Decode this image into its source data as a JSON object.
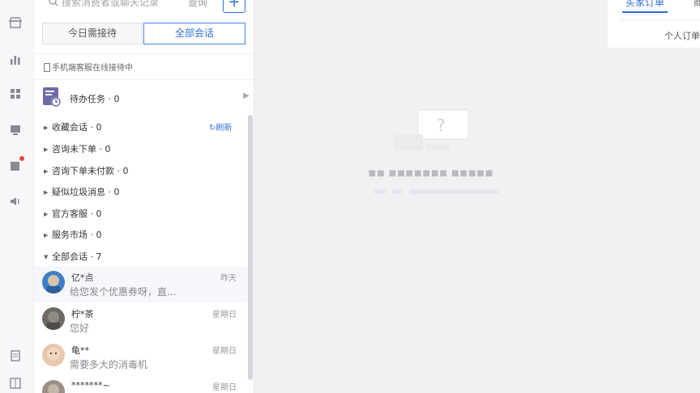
{
  "search": {
    "placeholder": "搜索消费者或聊天记录",
    "button_label": "查询",
    "add_symbol": "+"
  },
  "tabs": [
    {
      "label": "今日需接待"
    },
    {
      "label": "全部会话"
    }
  ],
  "mobile_notice": "手机端客服在线接待中",
  "todo": {
    "label": "待办任务 · 0"
  },
  "refresh_label": "刷新",
  "groups": [
    {
      "label": "收藏会话 · 0"
    },
    {
      "label": "咨询未下单 · 0"
    },
    {
      "label": "咨询下单未付款 · 0"
    },
    {
      "label": "疑似垃圾消息 · 0"
    },
    {
      "label": "官方客服 · 0"
    },
    {
      "label": "服务市场 · 0"
    },
    {
      "label": "全部会话 · 7"
    }
  ],
  "conversations": [
    {
      "name": "亿*点",
      "message": "给您发个优惠券呀，直...",
      "time": "昨天"
    },
    {
      "name": "柠*茶",
      "message": "您好",
      "time": "星期日"
    },
    {
      "name": "龟**",
      "message": "需要多大的消毒机",
      "time": "星期日"
    },
    {
      "name": "*******~",
      "message": "",
      "time": "星期日"
    }
  ],
  "right_panel": {
    "tab_buyer_orders": "买家订单",
    "tab_next": "商",
    "personal_orders": "个人订单"
  },
  "colors": {
    "accent": "#2f6fd6",
    "badge_red": "#e64a3b"
  }
}
